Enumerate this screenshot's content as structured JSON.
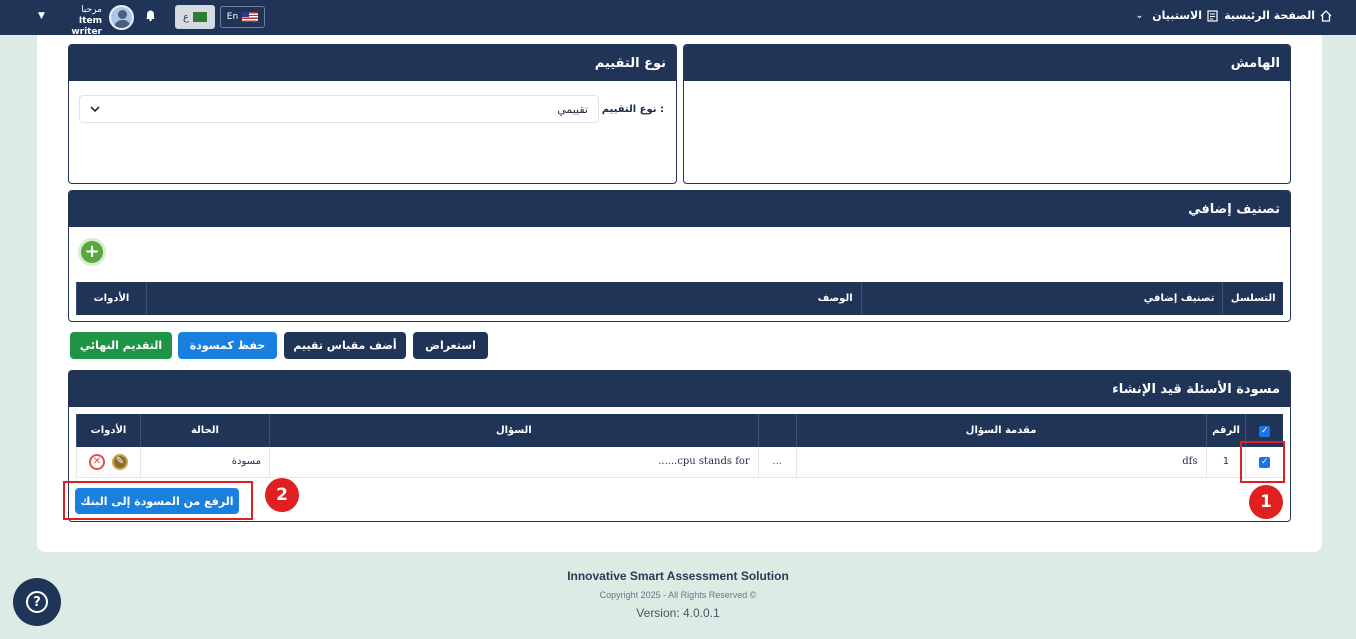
{
  "topbar": {
    "home_label": "الصفحة الرئيسية",
    "breadcrumb_label": "الاستبيان",
    "lang_en": "En",
    "lang_ar": "ع",
    "user_greeting": "مرحبا",
    "user_name": "Item writer"
  },
  "margin_panel": {
    "title": "الهامش"
  },
  "eval_panel": {
    "title": "نوع التقييم",
    "field_label": "نوع التقييم :",
    "selected": "تقييمي"
  },
  "classification_panel": {
    "title": "تصنيف إضافي",
    "columns": [
      "التسلسل",
      "تصنيف إضافي",
      "الوصف",
      "الأدوات"
    ]
  },
  "actions": {
    "final_submit": "التقديم النهائي",
    "save_draft": "حفظ كمسودة",
    "add_scale": "أضف مقياس تقييم",
    "preview": "استعراض"
  },
  "drafts_panel": {
    "title": "مسودة الأسئلة قيد الإنشاء",
    "columns": {
      "number": "الرقم",
      "intro": "مقدمة السؤال",
      "question": "السؤال",
      "status": "الحالة",
      "tools": "الأدوات"
    },
    "rows": [
      {
        "number": "1",
        "intro": "dfs",
        "more": "...",
        "question": "......cpu stands for",
        "status": "مسودة"
      }
    ],
    "upload_button": "الرفع من المسودة إلى البنك"
  },
  "annotations": {
    "badge1": "1",
    "badge2": "2",
    "color": "#e02020"
  },
  "footer": {
    "product": "Innovative Smart Assessment Solution",
    "copyright": "Copyright 2025 - All Rights Reserved ©",
    "version": "Version: 4.0.0.1"
  },
  "colors": {
    "navy": "#1f3457",
    "blue": "#1a80e0",
    "green": "#1e9447"
  }
}
